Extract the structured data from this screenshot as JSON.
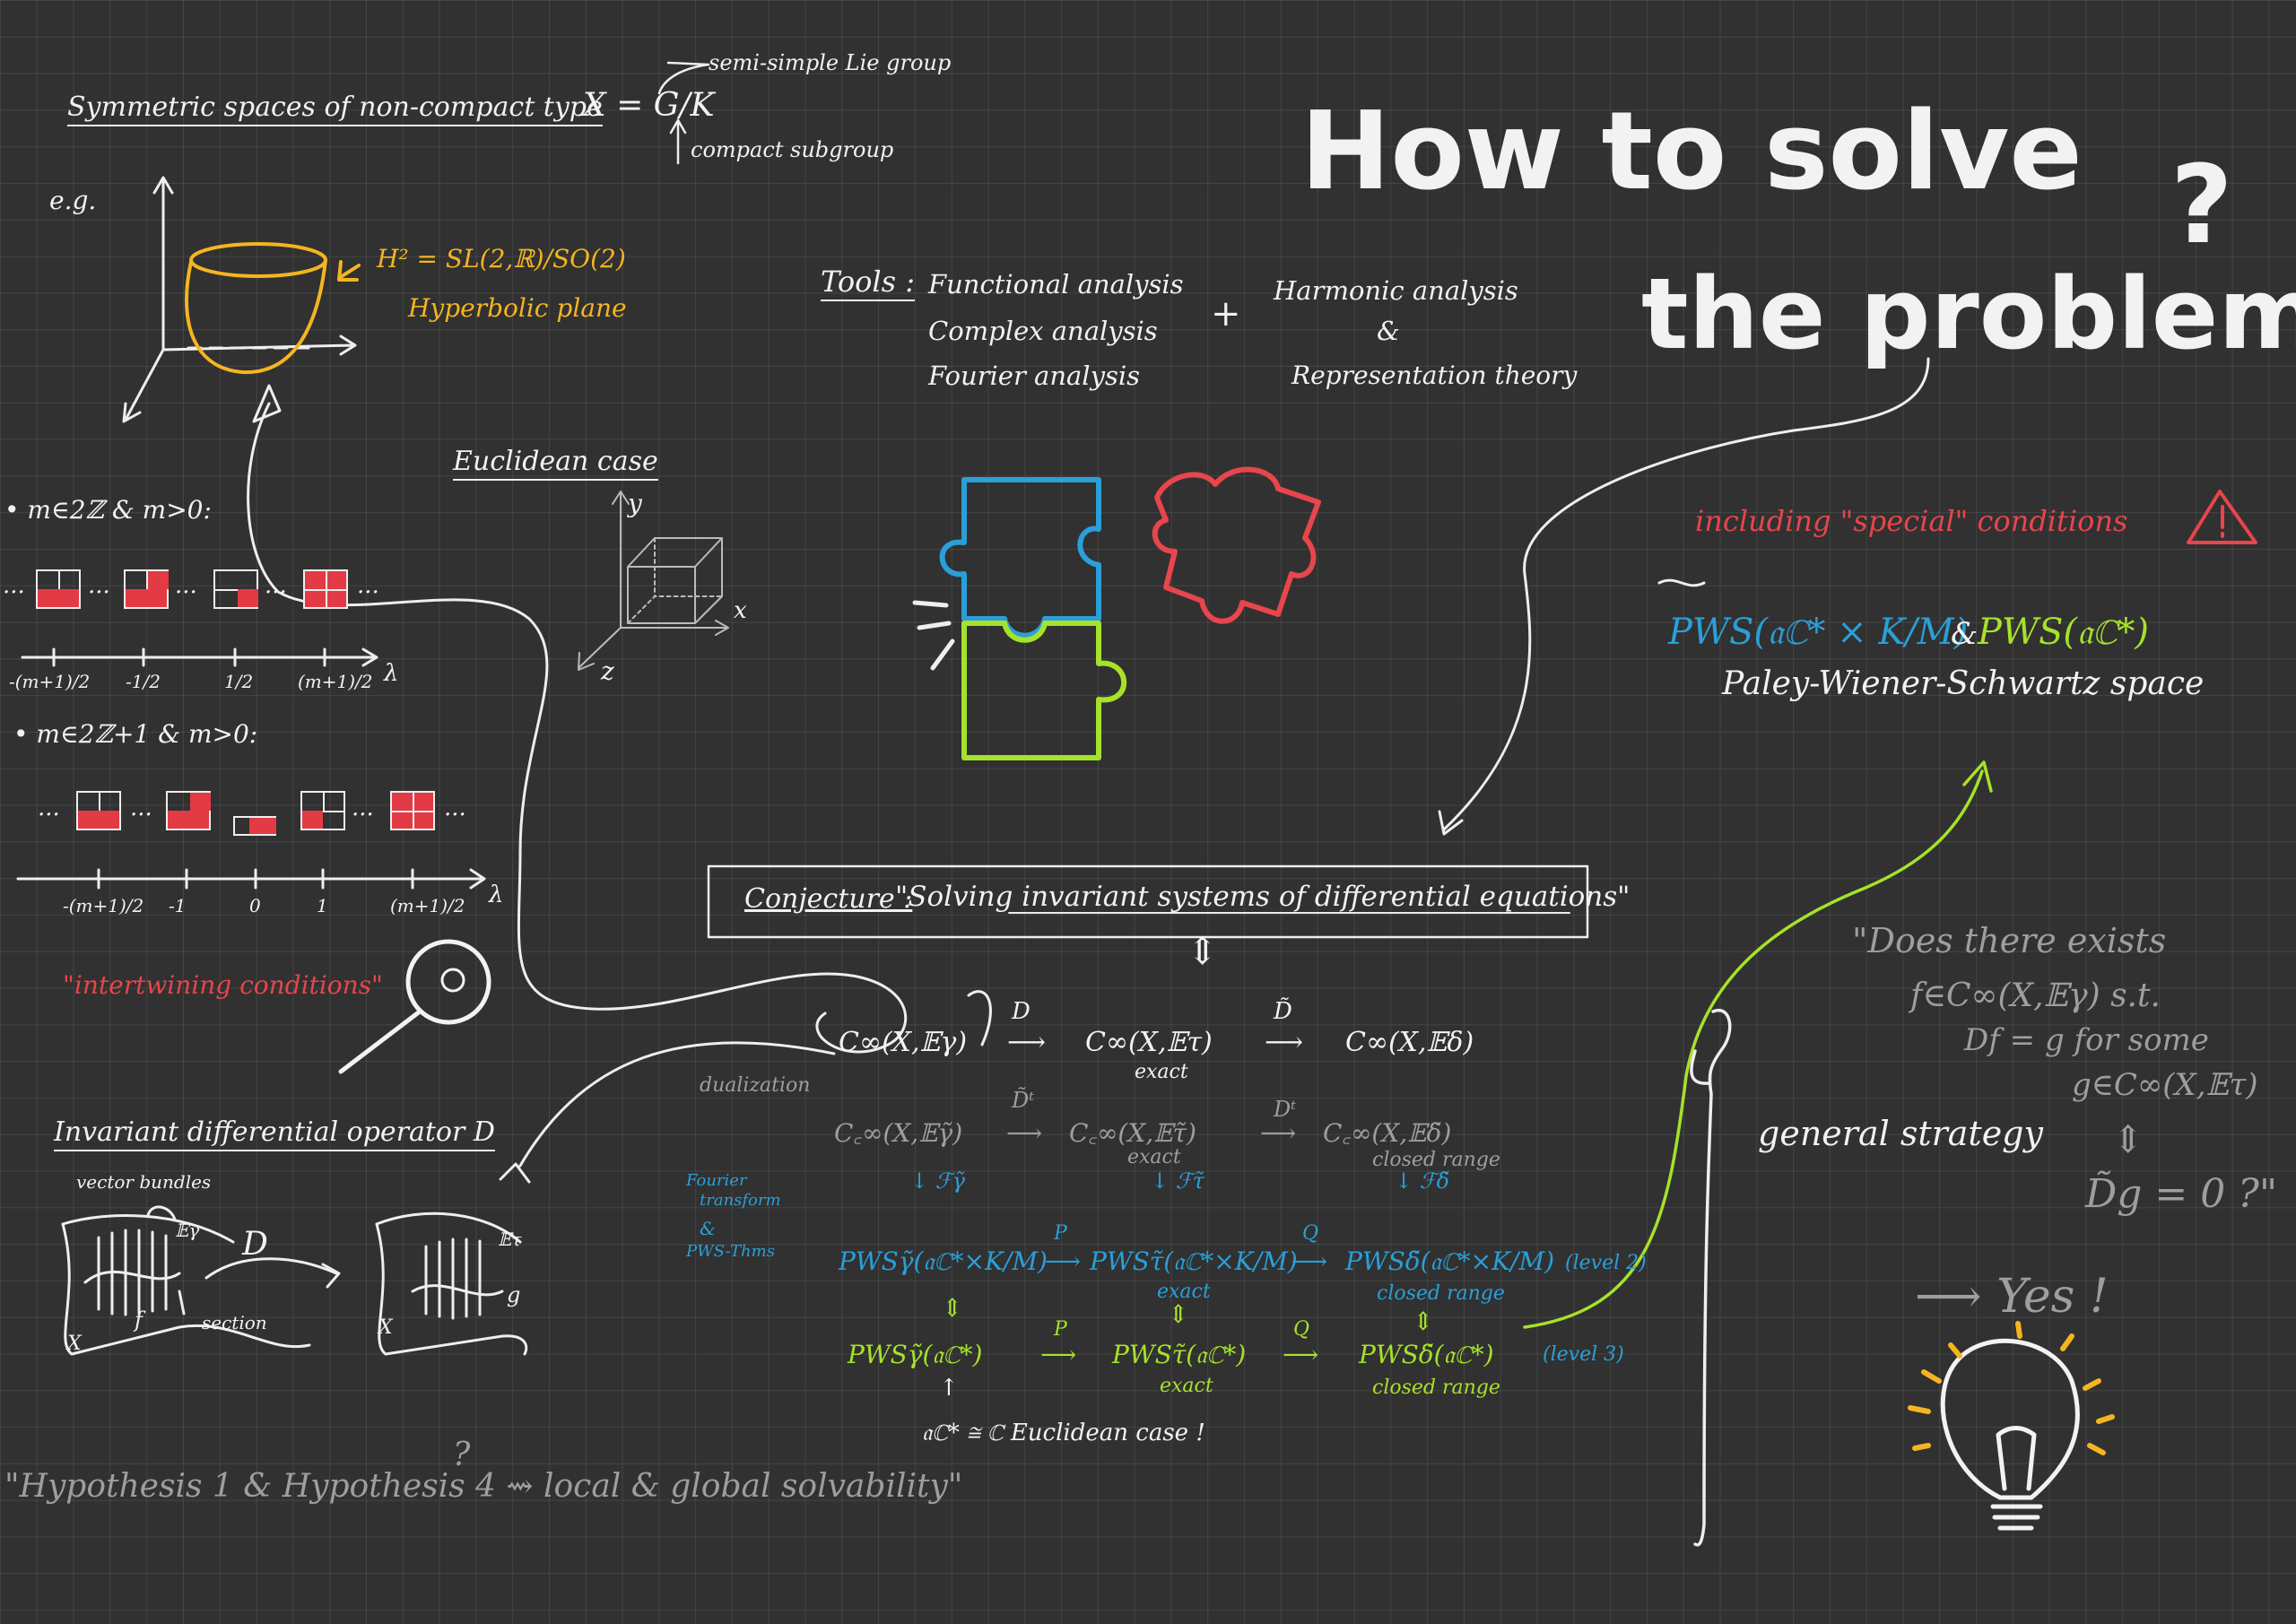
{
  "title": {
    "line1": "How to solve",
    "line2": "the problem",
    "qmark": "?"
  },
  "header": {
    "symmetric_spaces": "Symmetric spaces of non-compact type",
    "x_eq": "X = G/K",
    "semisimple": "semi-simple Lie group",
    "compact": "compact subgroup",
    "eg": "e.g.",
    "h2": "H² = SL(2,ℝ)/SO(2)",
    "hyperbolic": "Hyperbolic plane"
  },
  "tools": {
    "label": "Tools :",
    "items": [
      "Functional analysis",
      "Complex analysis",
      "Fourier analysis"
    ],
    "plus": "+",
    "harmonic": "Harmonic analysis",
    "amp": "&",
    "representation": "Representation theory"
  },
  "euclidean": {
    "label": "Euclidean case",
    "y": "y",
    "x": "x",
    "z": "z"
  },
  "spectrum": {
    "even_label": "• m∈2ℤ & m>0:",
    "odd_label": "• m∈2ℤ+1 & m>0:",
    "even_ticks": [
      "-(m+1)/2",
      "-1/2",
      "1/2",
      "(m+1)/2"
    ],
    "odd_ticks": [
      "-(m+1)/2",
      "-1",
      "0",
      "1",
      "(m+1)/2"
    ],
    "lambda": "λ",
    "dots": "...",
    "intertwining": "\"intertwining conditions\""
  },
  "special": {
    "including": "including \"special\" conditions",
    "pws_blue": "PWS(𝔞ℂ* × K/M)",
    "amp": "&",
    "pws_green": "PWS(𝔞ℂ*)",
    "paley": "Paley-Wiener-Schwartz space"
  },
  "conjecture": {
    "label": "Conjecture :",
    "text": "\"Solving invariant systems of differential equations\"",
    "equiv": "⇕"
  },
  "diagram": {
    "row1": {
      "c1": "C∞(X,𝔼γ)",
      "c2": "C∞(X,𝔼τ)",
      "c3": "C∞(X,𝔼δ)",
      "d": "D",
      "dt": "D̃",
      "exact": "exact"
    },
    "dualization": "dualization",
    "row2": {
      "c1": "C꜀∞(X,𝔼γ̃)",
      "c2": "C꜀∞(X,𝔼τ̃)",
      "c3": "C꜀∞(X,𝔼δ̃)",
      "d1": "D̃ᵗ",
      "d2": "Dᵗ",
      "exact": "exact",
      "closed": "closed range"
    },
    "fourier": {
      "f1": "↓ ℱγ̃",
      "f2": "↓ ℱτ̃",
      "f3": "↓ ℱδ̃"
    },
    "fourier_label": [
      "Fourier",
      "transform",
      "&",
      "PWS-Thms"
    ],
    "row3": {
      "c1": "PWSγ̃(𝔞ℂ*×K/M)",
      "c2": "PWSτ̃(𝔞ℂ*×K/M)",
      "c3": "PWSδ̃(𝔞ℂ*×K/M)",
      "p": "P",
      "q": "Q",
      "exact": "exact",
      "closed": "closed range",
      "level": "(level 2)"
    },
    "row4": {
      "c1": "PWSγ̃(𝔞ℂ*)",
      "c2": "PWSτ̃(𝔞ℂ*)",
      "c3": "PWSδ̃(𝔞ℂ*)",
      "p": "P",
      "q": "Q",
      "exact": "exact",
      "closed": "closed range",
      "level": "(level 3)"
    },
    "bottom": "𝔞ℂ* ≅ ℂ  Euclidean case !"
  },
  "operator": {
    "title": "Invariant differential operator D",
    "vector_bundles": "vector bundles",
    "eg": "𝔼γ",
    "et": "𝔼τ",
    "d": "D",
    "section": "section",
    "f": "f",
    "g": "g",
    "x": "X"
  },
  "hypothesis": "\"Hypothesis 1 & Hypothesis 4 ⇝ local & global solvability\"",
  "hyp_q": "?",
  "question": {
    "line1": "\"Does there exists",
    "line2": "f∈C∞(X,𝔼γ) s.t.",
    "line3": "Df = g for some",
    "line4": "g∈C∞(X,𝔼τ)",
    "line5": "⇕",
    "line6": "D̃g = 0 ?\""
  },
  "general_strategy": "general strategy",
  "yes": "⟶ Yes !",
  "colors": {
    "background": "#313131",
    "chalk_white": "#f2f2f2",
    "blue": "#2a9fd8",
    "red": "#e8454c",
    "yellow": "#f4b521",
    "lime": "#a6e22a",
    "grey": "#9e9e9e"
  }
}
